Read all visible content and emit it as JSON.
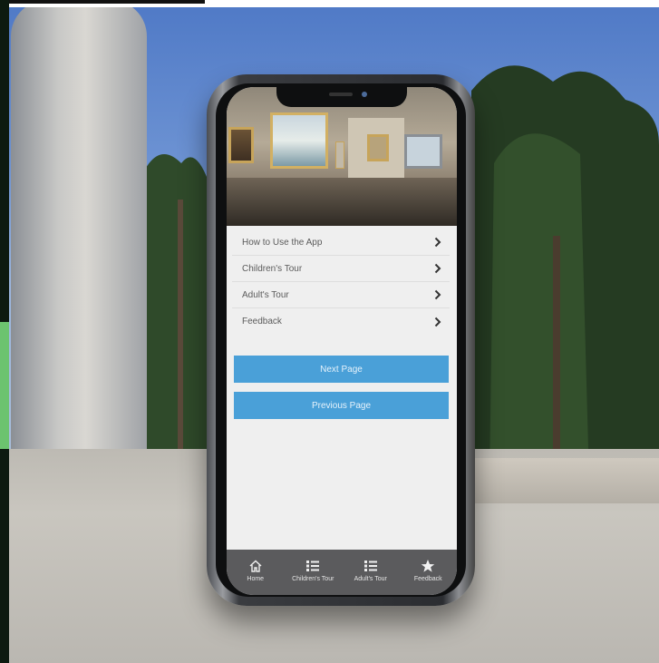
{
  "app": {
    "menu": [
      {
        "label": "How to Use the App"
      },
      {
        "label": "Children's Tour"
      },
      {
        "label": "Adult's Tour"
      },
      {
        "label": "Feedback"
      }
    ],
    "buttons": {
      "next": "Next Page",
      "previous": "Previous Page"
    },
    "tabs": [
      {
        "label": "Home",
        "icon": "home-icon"
      },
      {
        "label": "Children's Tour",
        "icon": "list-icon"
      },
      {
        "label": "Adult's Tour",
        "icon": "list-icon"
      },
      {
        "label": "Feedback",
        "icon": "star-icon"
      }
    ],
    "colors": {
      "accent": "#4aa0d8",
      "tabbar": "#5b5b5d",
      "menu_background": "#efefef"
    }
  }
}
